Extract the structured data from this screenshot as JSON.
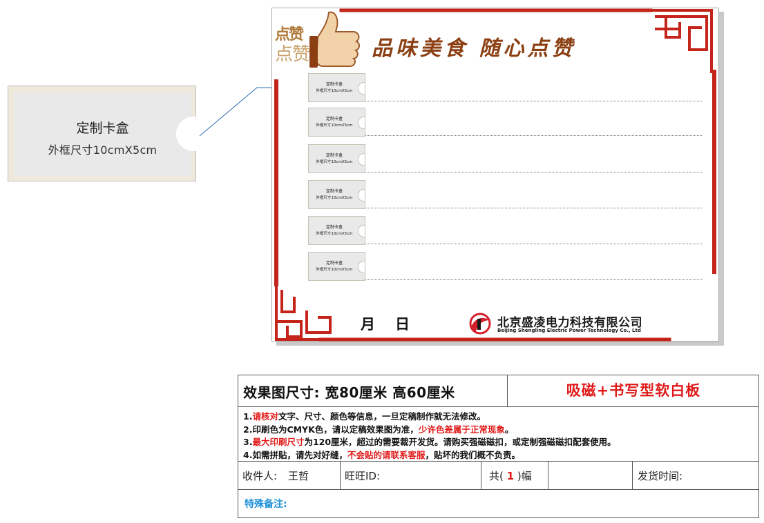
{
  "zoom_card": {
    "title": "定制卡盒",
    "size": "外框尺寸10cmX5cm"
  },
  "board": {
    "logo_top": "点赞",
    "logo_bottom": "点赞",
    "title": "品味美食 随心点赞",
    "slots": [
      {
        "title": "定制卡盒",
        "size": "外框尺寸10cmX5cm"
      },
      {
        "title": "定制卡盒",
        "size": "外框尺寸10cmX5cm"
      },
      {
        "title": "定制卡盒",
        "size": "外框尺寸10cmX5cm"
      },
      {
        "title": "定制卡盒",
        "size": "外框尺寸10cmX5cm"
      },
      {
        "title": "定制卡盒",
        "size": "外框尺寸10cmX5cm"
      },
      {
        "title": "定制卡盒",
        "size": "外框尺寸10cmX5cm"
      }
    ],
    "month_label": "月",
    "day_label": "日",
    "company_cn": "北京盛凌电力科技有限公司",
    "company_en": "Beijing Shengling Electric Power Technology Co., Ltd"
  },
  "spec": {
    "size_label": "效果图尺寸: 宽80厘米  高60厘米",
    "product_type": "吸磁+书写型软白板",
    "notes": [
      {
        "p1": "1.",
        "r1": "请核对",
        "p2": "文字、尺寸、颜色等信息，一旦定稿制作就无法修改。",
        "r2": "",
        "p3": ""
      },
      {
        "p1": "2.印刷色为CMYK色，请以定稿效果图为准，",
        "r1": "少许色差属于正常现象",
        "p2": "。",
        "r2": "",
        "p3": ""
      },
      {
        "p1": "3.",
        "r1": "最大印刷尺寸",
        "p2": "为120厘米，超过的需要裁开发货。请购买强磁磁扣，或定制强磁磁扣配套使用。",
        "r2": "",
        "p3": ""
      },
      {
        "p1": "4.如需拼贴，请先对好缝，",
        "r1": "不会贴的请联系客服",
        "p2": "，贴坏的我们概不负责。",
        "r2": "",
        "p3": ""
      }
    ],
    "recipient_label": "收件人:",
    "recipient_name": "王哲",
    "wangwang_label": "旺旺ID:",
    "count_prefix": "共(",
    "count_value": "1",
    "count_suffix": ")幅",
    "ship_time_label": "发货时间:",
    "special_note_label": "特殊备注:"
  },
  "colors": {
    "frame_red": "#c4241a",
    "title_brown": "#8b3f13",
    "accent_red": "#e01a1a",
    "note_blue": "#1a8fd8",
    "logo_red": "#d4202a"
  }
}
